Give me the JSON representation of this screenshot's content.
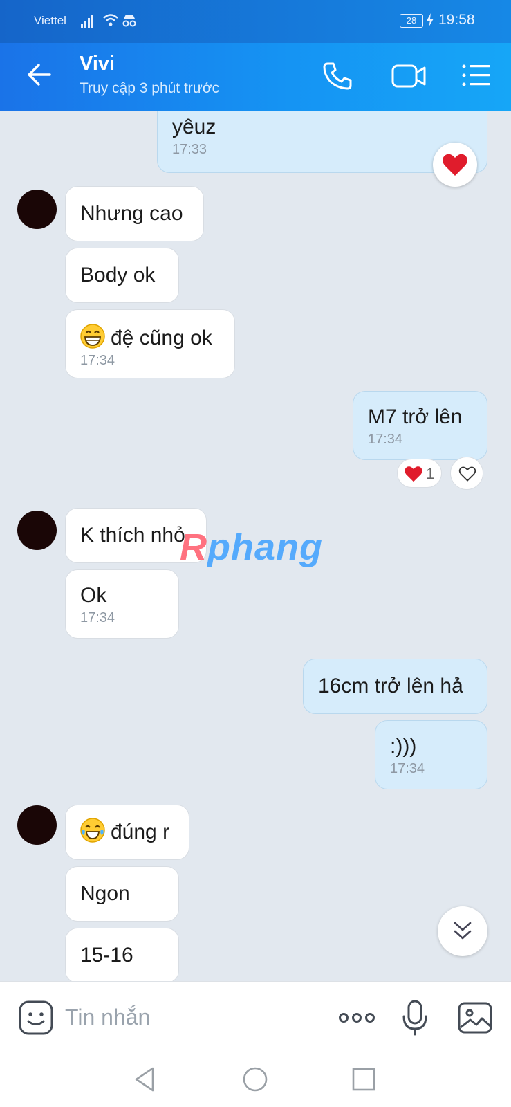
{
  "status_bar": {
    "carrier": "Viettel",
    "battery": "28",
    "time": "19:58"
  },
  "header": {
    "contact_name": "Vivi",
    "last_seen": "Truy cập 3 phút trước",
    "icons": [
      "back-arrow-icon",
      "phone-call-icon",
      "video-call-icon",
      "menu-list-icon"
    ]
  },
  "messages": {
    "out_partial": {
      "text": "yêuz",
      "time": "17:33",
      "reaction": "heart-icon"
    },
    "in_1": {
      "text": "Nhưng cao"
    },
    "in_2": {
      "text": "Body ok"
    },
    "in_3": {
      "text": "đệ cũng ok",
      "time": "17:34",
      "emoji": "grinning-face-icon"
    },
    "out_1": {
      "text": "M7 trở lên",
      "time": "17:34",
      "reaction_count": "1"
    },
    "in_4": {
      "text": "K thích nhỏ"
    },
    "in_5": {
      "text": "Ok",
      "time": "17:34"
    },
    "out_2": {
      "text": "16cm trở lên hả"
    },
    "out_3": {
      "text": ":)))",
      "time": "17:34"
    },
    "in_6": {
      "text": "đúng r",
      "emoji": "tears-of-joy-icon"
    },
    "in_7": {
      "text": "Ngon"
    },
    "in_8": {
      "text": "15-16"
    }
  },
  "watermark": {
    "first": "R",
    "rest": "phang"
  },
  "input": {
    "placeholder": "Tin nhắn"
  },
  "colors": {
    "header": "#1a73e8",
    "out_bubble": "#d6ecfb",
    "in_bubble": "#ffffff",
    "chat_bg": "#e2e8ef"
  }
}
